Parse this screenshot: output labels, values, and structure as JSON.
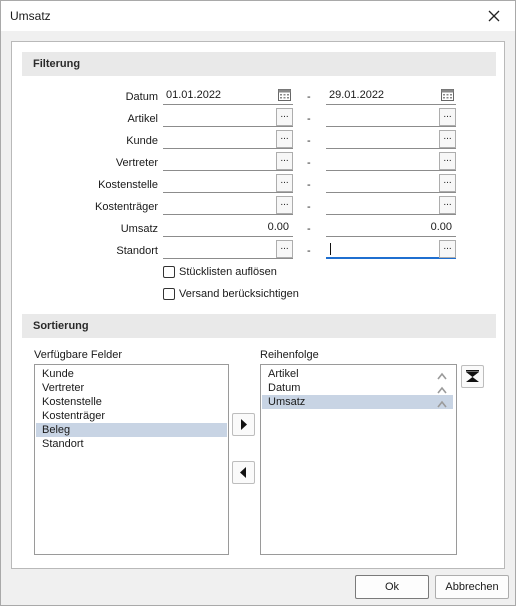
{
  "window": {
    "title": "Umsatz"
  },
  "filter": {
    "header": "Filterung",
    "separator": "-",
    "rows": [
      {
        "label": "Datum",
        "from": "01.01.2022",
        "to": "29.01.2022"
      },
      {
        "label": "Artikel",
        "from": "",
        "to": ""
      },
      {
        "label": "Kunde",
        "from": "",
        "to": ""
      },
      {
        "label": "Vertreter",
        "from": "",
        "to": ""
      },
      {
        "label": "Kostenstelle",
        "from": "",
        "to": ""
      },
      {
        "label": "Kostenträger",
        "from": "",
        "to": ""
      },
      {
        "label": "Umsatz",
        "from": "0.00",
        "to": "0.00"
      },
      {
        "label": "Standort",
        "from": "",
        "to": ""
      }
    ],
    "dots_label": "...",
    "checkboxes": [
      {
        "label": "Stücklisten auflösen",
        "checked": false
      },
      {
        "label": "Versand berücksichtigen",
        "checked": false
      }
    ]
  },
  "sort": {
    "header": "Sortierung",
    "available_label": "Verfügbare Felder",
    "available": [
      "Kunde",
      "Vertreter",
      "Kostenstelle",
      "Kostenträger",
      "Beleg",
      "Standort"
    ],
    "available_selected": "Beleg",
    "order_label": "Reihenfolge",
    "order": [
      "Artikel",
      "Datum",
      "Umsatz"
    ],
    "order_selected": "Umsatz"
  },
  "buttons": {
    "ok": "Ok",
    "cancel": "Abbrechen"
  }
}
